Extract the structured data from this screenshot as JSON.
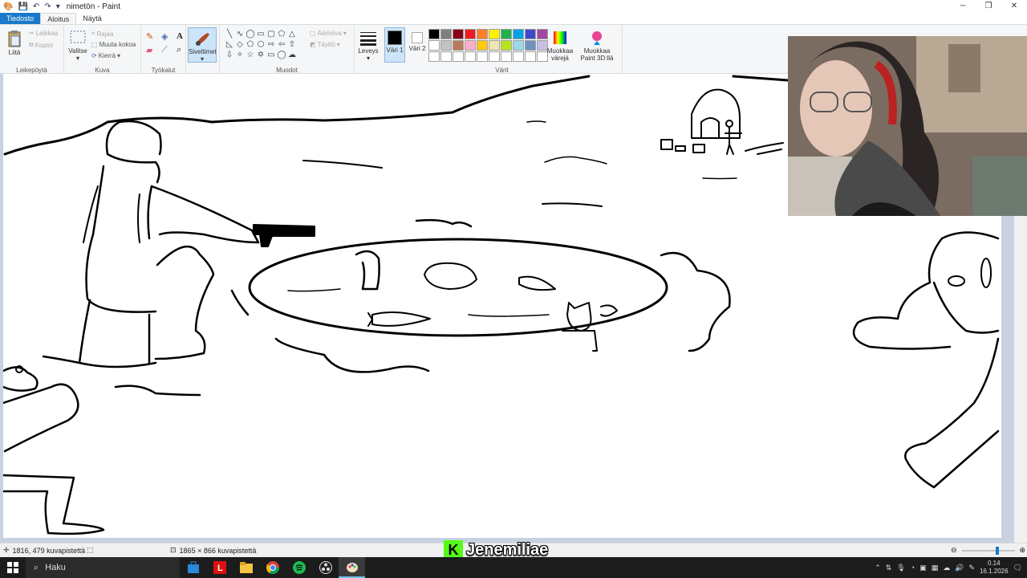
{
  "window": {
    "title": "nimetön - Paint"
  },
  "tabs": {
    "file": "Tiedosto",
    "home": "Aloitus",
    "view": "Näytä"
  },
  "ribbon": {
    "clipboard": {
      "label": "Leikepöytä",
      "paste": "Liitä",
      "cut": "Leikkaa",
      "copy": "Kopioi"
    },
    "image": {
      "label": "Kuva",
      "select": "Valitse",
      "crop": "Rajaa",
      "resize": "Muuta kokoa",
      "rotate": "Kierrä"
    },
    "tools": {
      "label": "Työkalut"
    },
    "brushes": {
      "label": "Siveltimet"
    },
    "shapes": {
      "label": "Muodot",
      "outline": "Ääriviiva",
      "fill": "Täyttö"
    },
    "size": {
      "label": "Leveys"
    },
    "colors": {
      "label": "Värit",
      "color1": "Väri 1",
      "color2": "Väri 2",
      "edit": "Muokkaa värejä",
      "paint3d": "Muokkaa Paint 3D:llä",
      "color1_value": "#000000",
      "color2_value": "#ffffff",
      "palette": [
        "#000000",
        "#7f7f7f",
        "#880015",
        "#ed1c24",
        "#ff7f27",
        "#fff200",
        "#22b14c",
        "#00a2e8",
        "#3f48cc",
        "#a349a4",
        "#ffffff",
        "#c3c3c3",
        "#b97a57",
        "#ffaec9",
        "#ffc90e",
        "#efe4b0",
        "#b5e61d",
        "#99d9ea",
        "#7092be",
        "#c8bfe7",
        "#ffffff",
        "#ffffff",
        "#ffffff",
        "#ffffff",
        "#ffffff",
        "#ffffff",
        "#ffffff",
        "#ffffff",
        "#ffffff",
        "#ffffff"
      ]
    }
  },
  "status": {
    "cursor_pos": "1816, 479 kuvapistettä",
    "canvas_size": "1865 × 866 kuvapistettä"
  },
  "overlay": {
    "streamer": "Jenemiliae"
  },
  "taskbar": {
    "search": "Haku",
    "time": "0.14",
    "date": "16.1.2026"
  }
}
